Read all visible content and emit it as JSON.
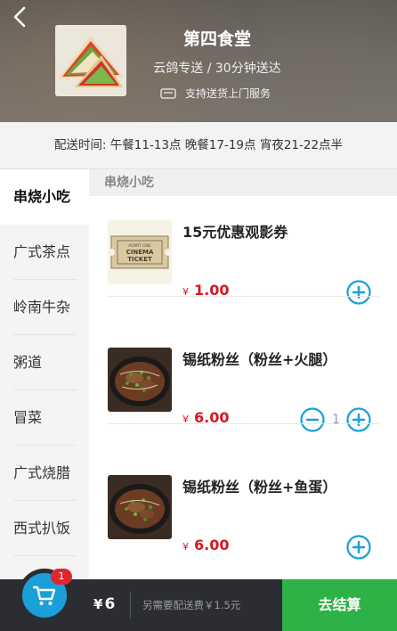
{
  "header": {
    "shop_name": "第四食堂",
    "delivery_info": "云鸽专送 / 30分钟送达",
    "service_note": "支持送货上门服务"
  },
  "time_bar": {
    "text": "配送时间:  午餐11-13点 晚餐17-19点 宵夜21-22点半"
  },
  "categories": [
    {
      "label": "串烧小吃",
      "active": true
    },
    {
      "label": "广式茶点",
      "active": false
    },
    {
      "label": "岭南牛杂",
      "active": false
    },
    {
      "label": "粥道",
      "active": false
    },
    {
      "label": "冒菜",
      "active": false
    },
    {
      "label": "广式烧腊",
      "active": false
    },
    {
      "label": "西式扒饭",
      "active": false
    }
  ],
  "section": {
    "title": "串烧小吃"
  },
  "products": [
    {
      "name": "15元优惠观影券",
      "currency": "¥",
      "price": "1.00",
      "quantity": null,
      "ticket_line1": "ADMIT ONE",
      "ticket_line2": "CINEMA",
      "ticket_line3": "TICKET"
    },
    {
      "name": "锡纸粉丝（粉丝+火腿）",
      "currency": "¥",
      "price": "6.00",
      "quantity": "1"
    },
    {
      "name": "锡纸粉丝（粉丝+鱼蛋）",
      "currency": "¥",
      "price": "6.00",
      "quantity": null
    }
  ],
  "cart": {
    "badge": "1",
    "currency": "¥",
    "total": "6",
    "fee_note": "另需要配送费￥1.5元",
    "checkout_label": "去结算"
  },
  "colors": {
    "accent_blue": "#1a9fd8",
    "price_red": "#d71920",
    "checkout_green": "#2eb146",
    "bottom_bar": "#2b2d33"
  }
}
